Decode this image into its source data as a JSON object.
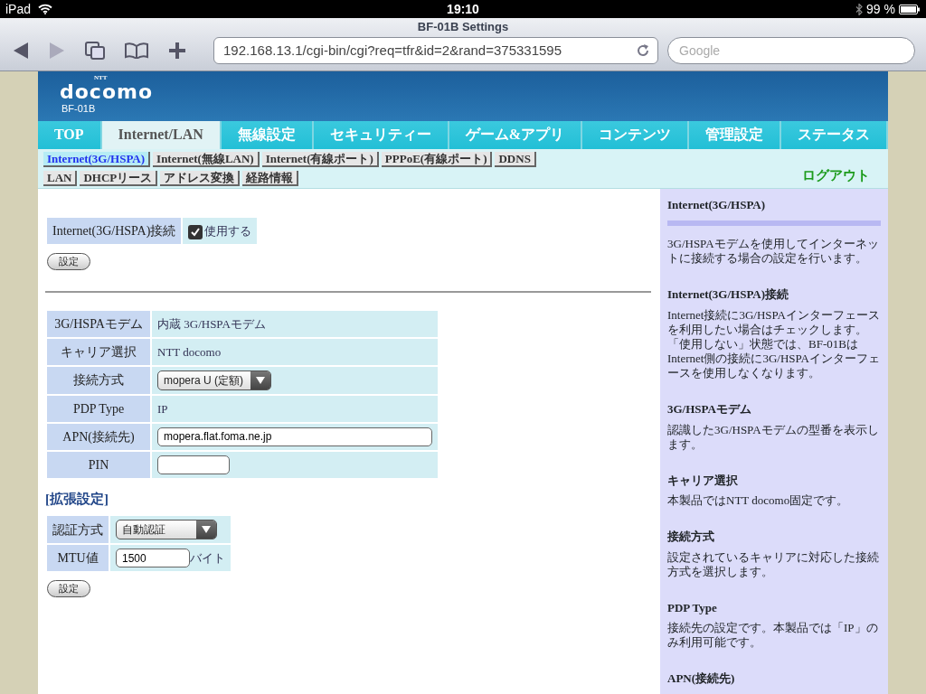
{
  "status_bar": {
    "carrier": "iPad",
    "time": "19:10",
    "battery": "99 %"
  },
  "browser": {
    "title": "BF-01B Settings",
    "back_disabled": false,
    "forward_disabled": true,
    "url": "192.168.13.1/cgi-bin/cgi?req=tfr&id=2&rand=375331595",
    "search": {
      "placeholder": "Google"
    }
  },
  "header": {
    "brand_small": "NTT",
    "brand": "docomo",
    "model": "BF-01B"
  },
  "tabs": [
    {
      "label": "TOP",
      "selected": false
    },
    {
      "label": "Internet/LAN",
      "selected": true
    },
    {
      "label": "無線設定",
      "selected": false
    },
    {
      "label": "セキュリティー",
      "selected": false
    },
    {
      "label": "ゲーム&アプリ",
      "selected": false
    },
    {
      "label": "コンテンツ",
      "selected": false
    },
    {
      "label": "管理設定",
      "selected": false
    },
    {
      "label": "ステータス",
      "selected": false
    }
  ],
  "subtab_rows": [
    {
      "items": [
        {
          "label": "Internet(3G/HSPA)",
          "selected": true
        },
        {
          "label": "Internet(無線LAN)",
          "selected": false
        },
        {
          "label": "Internet(有線ポート)",
          "selected": false
        },
        {
          "label": "PPPoE(有線ポート)",
          "selected": false
        },
        {
          "label": "DDNS",
          "selected": false
        }
      ]
    },
    {
      "items": [
        {
          "label": "LAN",
          "selected": false
        },
        {
          "label": "DHCPリース",
          "selected": false
        },
        {
          "label": "アドレス変換",
          "selected": false
        },
        {
          "label": "経路情報",
          "selected": false
        }
      ]
    }
  ],
  "logout": "ログアウト",
  "connection": {
    "label": "Internet(3G/HSPA)接続",
    "option": "使用する",
    "checked": true,
    "button": "設定"
  },
  "settings": [
    {
      "label": "3G/HSPAモデム",
      "kind": "text",
      "value": "内蔵 3G/HSPAモデム"
    },
    {
      "label": "キャリア選択",
      "kind": "text",
      "value": "NTT docomo"
    },
    {
      "label": "接続方式",
      "kind": "select",
      "value": "mopera U (定額)"
    },
    {
      "label": "PDP Type",
      "kind": "text",
      "value": "IP"
    },
    {
      "label": "APN(接続先)",
      "kind": "input",
      "value": "mopera.flat.foma.ne.jp"
    },
    {
      "label": "PIN",
      "kind": "input"
    }
  ],
  "extended": {
    "title": "[拡張設定]",
    "rows": [
      {
        "label": "認証方式",
        "kind": "select",
        "value": "自動認証"
      },
      {
        "label": "MTU値",
        "kind": "input",
        "value": "1500",
        "unit": "バイト"
      }
    ],
    "button": "設定"
  },
  "help": {
    "title": "Internet(3G/HSPA)",
    "intro": "3G/HSPAモデムを使用してインターネットに接続する場合の設定を行います。",
    "sections": [
      {
        "heading": "Internet(3G/HSPA)接続",
        "text": "Internet接続に3G/HSPAインターフェースを利用したい場合はチェックします。「使用しない」状態では、BF-01BはInternet側の接続に3G/HSPAインターフェースを使用しなくなります。"
      },
      {
        "heading": "3G/HSPAモデム",
        "text": "認識した3G/HSPAモデムの型番を表示します。"
      },
      {
        "heading": "キャリア選択",
        "text": "本製品ではNTT docomo固定です。"
      },
      {
        "heading": "接続方式",
        "text": "設定されているキャリアに対応した接続方式を選択します。"
      },
      {
        "heading": "PDP Type",
        "text": "接続先の設定です。本製品では「IP」のみ利用可能です。"
      },
      {
        "heading": "APN(接続先)"
      }
    ]
  }
}
